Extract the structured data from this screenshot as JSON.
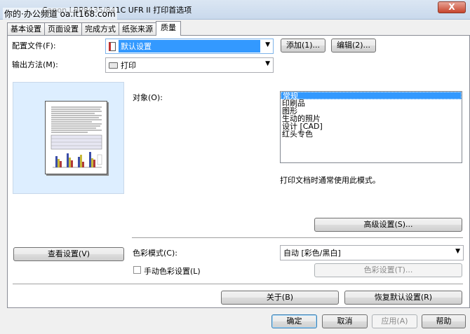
{
  "window": {
    "title": "Canon LBP8435/841C UFR II 打印首选项",
    "watermark": "你的·办公频道 oa.it168.com",
    "close": "X"
  },
  "tabs": [
    {
      "label": "基本设置"
    },
    {
      "label": "页面设置"
    },
    {
      "label": "完成方式"
    },
    {
      "label": "纸张来源"
    },
    {
      "label": "质量"
    }
  ],
  "profile": {
    "label": "配置文件(F):",
    "value": "默认设置",
    "add_label": "添加(1)...",
    "edit_label": "编辑(2)..."
  },
  "output": {
    "label": "输出方法(M):",
    "value": "打印"
  },
  "target": {
    "label": "对象(O):",
    "items": [
      "常规",
      "印刷品",
      "图形",
      "生动的照片",
      "设计 [CAD]",
      "红头专色"
    ],
    "description": "打印文档时通常使用此模式。",
    "advanced_label": "高级设置(S)..."
  },
  "view_settings_label": "查看设置(V)",
  "color": {
    "mode_label": "色彩模式(C):",
    "mode_value": "自动 [彩色/黑白]",
    "manual_label": "手动色彩设置(L)",
    "settings_label": "色彩设置(T)..."
  },
  "panel_buttons": {
    "about": "关于(B)",
    "restore": "恢复默认设置(R)"
  },
  "dialog_buttons": {
    "ok": "确定",
    "cancel": "取消",
    "apply": "应用(A)",
    "help": "帮助"
  }
}
